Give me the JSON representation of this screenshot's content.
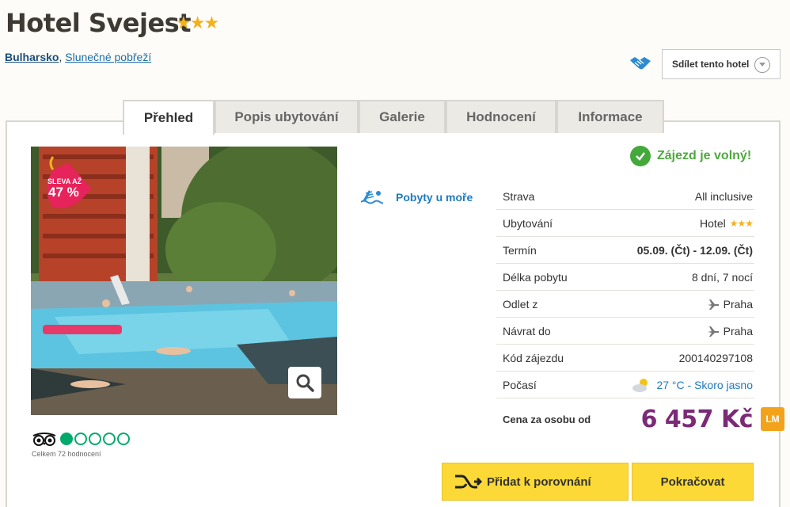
{
  "hotel": {
    "name": "Hotel Svejest",
    "stars": "★★★"
  },
  "breadcrumb": {
    "country": "Bulharsko",
    "separator": ",",
    "region": "Slunečné pobřeží"
  },
  "share": {
    "label": "Sdílet tento hotel",
    "icon": "handshake-icon"
  },
  "tabs": [
    {
      "label": "Přehled",
      "active": true
    },
    {
      "label": "Popis ubytování",
      "active": false
    },
    {
      "label": "Galerie",
      "active": false
    },
    {
      "label": "Hodnocení",
      "active": false
    },
    {
      "label": "Informace",
      "active": false
    }
  ],
  "photo": {
    "badge_line1": "SLEVA AŽ",
    "badge_line2": "47 %",
    "badge_color": "#e6235a"
  },
  "tripadvisor": {
    "rating": 1,
    "max": 5,
    "count_label": "Celkem 72 hodnocení"
  },
  "category": {
    "label": "Pobyty u moře",
    "icon": "sea-icon"
  },
  "status": {
    "label": "Zájezd je volný!",
    "color": "#4ea83e"
  },
  "details": {
    "strava": {
      "label": "Strava",
      "value": "All inclusive"
    },
    "ubytovani": {
      "label": "Ubytování",
      "value": "Hotel",
      "stars": "★★★"
    },
    "termin": {
      "label": "Termín",
      "value": "05.09. (Čt) - 12.09. (Čt)"
    },
    "delka": {
      "label": "Délka pobytu",
      "value": "8 dní, 7 nocí"
    },
    "odlet": {
      "label": "Odlet z",
      "value": "Praha"
    },
    "navrat": {
      "label": "Návrat do",
      "value": "Praha"
    },
    "kod": {
      "label": "Kód zájezdu",
      "value": "200140297108"
    },
    "pocasi": {
      "label": "Počasí",
      "value": "27 °C - Skoro jasno"
    }
  },
  "price": {
    "label": "Cena za osobu od",
    "value": "6 457 Kč",
    "badge": "LM",
    "color": "#7c2a78"
  },
  "actions": {
    "compare": "Přidat k porovnání",
    "continue": "Pokračovat"
  }
}
